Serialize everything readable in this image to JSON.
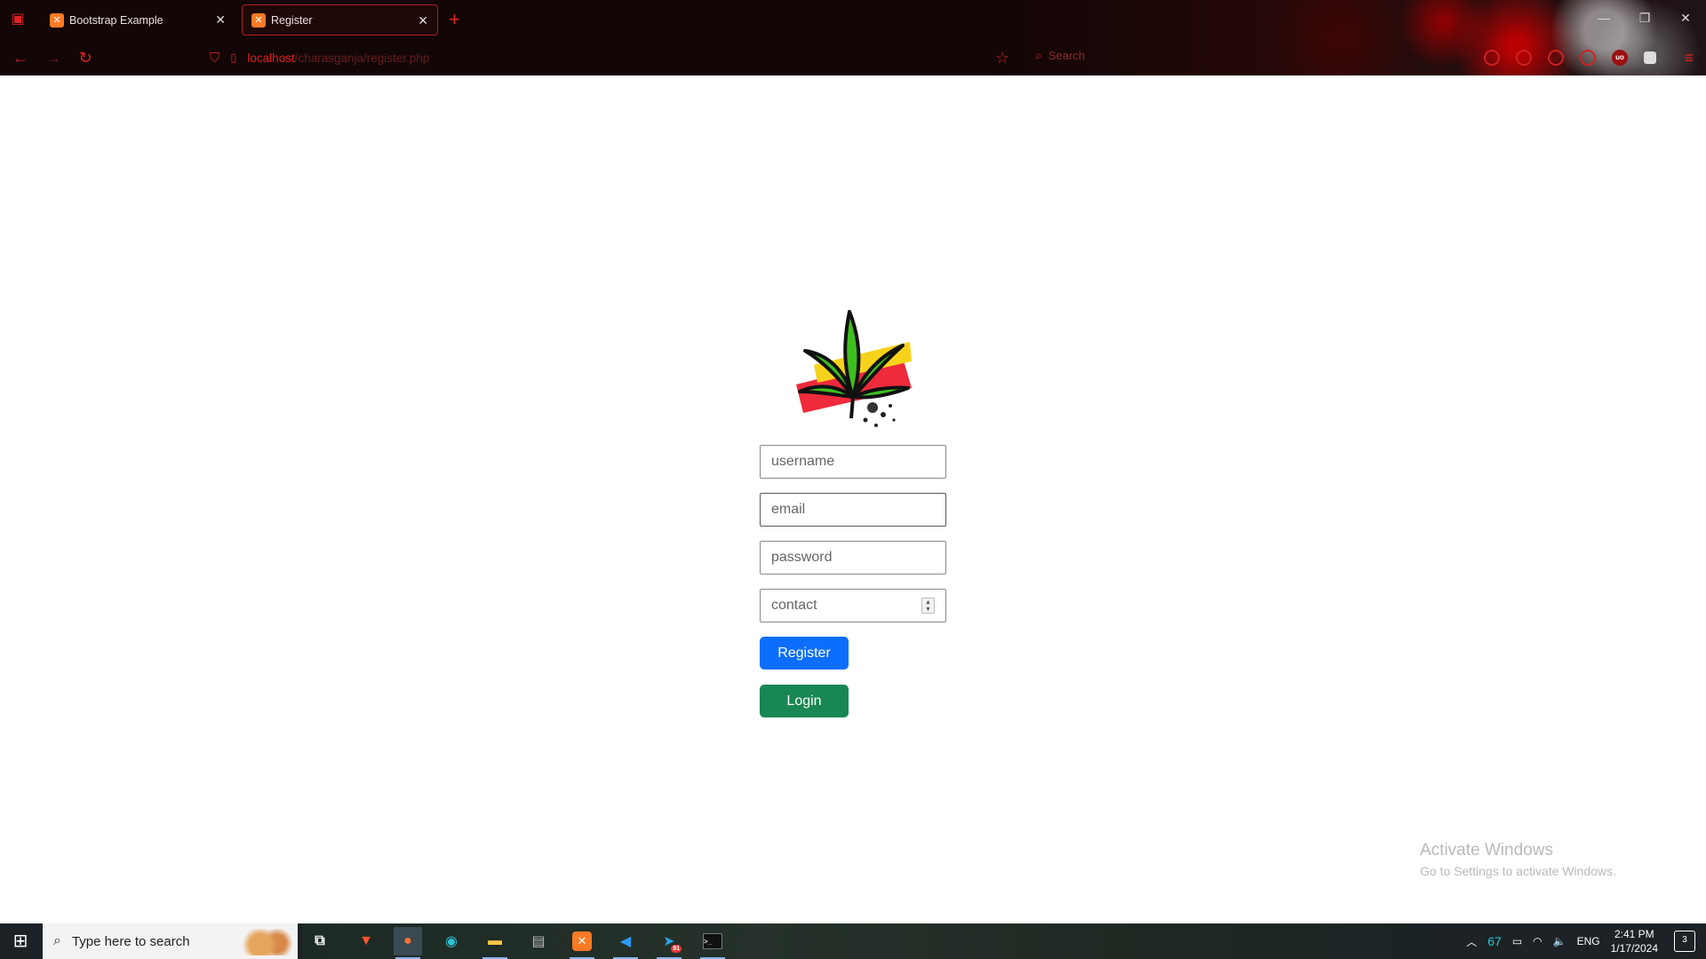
{
  "browser": {
    "tabs": [
      {
        "title": "Bootstrap Example",
        "favicon": "xampp-icon",
        "active": false
      },
      {
        "title": "Register",
        "favicon": "xampp-icon",
        "active": true
      }
    ],
    "url": {
      "host": "localhost",
      "path": "/charasganja/register.php"
    },
    "search_placeholder": "Search",
    "accent_color": "#e02020"
  },
  "page": {
    "logo": "cannabis-leaf-logo",
    "fields": {
      "username": {
        "placeholder": "username",
        "value": ""
      },
      "email": {
        "placeholder": "email",
        "value": ""
      },
      "password": {
        "placeholder": "password",
        "value": ""
      },
      "contact": {
        "placeholder": "contact",
        "value": ""
      }
    },
    "buttons": {
      "register": {
        "label": "Register",
        "color": "#0d6efd"
      },
      "login": {
        "label": "Login",
        "color": "#198754"
      }
    }
  },
  "watermark": {
    "title": "Activate Windows",
    "subtitle": "Go to Settings to activate Windows."
  },
  "taskbar": {
    "search_placeholder": "Type here to search",
    "temperature": "67",
    "language": "ENG",
    "time": "2:41 PM",
    "date": "1/17/2024",
    "notification_count": "3",
    "telegram_badge": "91"
  }
}
